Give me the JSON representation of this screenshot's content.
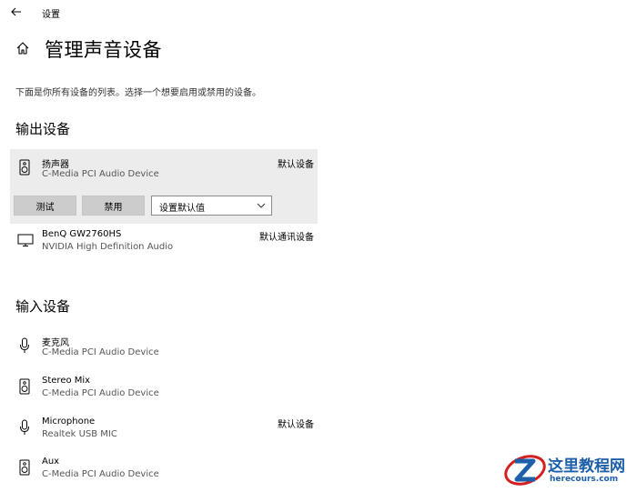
{
  "window": {
    "title": "设置",
    "back_icon": "back-arrow-icon"
  },
  "header": {
    "home_icon": "home-icon",
    "title": "管理声音设备",
    "description": "下面是你所有设备的列表。选择一个想要启用或禁用的设备。"
  },
  "output": {
    "section_title": "输出设备",
    "devices": [
      {
        "name": "扬声器",
        "subtitle": "C-Media PCI Audio Device",
        "status": "默认设备",
        "icon": "speaker-icon",
        "selected": true,
        "actions": {
          "test_label": "测试",
          "disable_label": "禁用",
          "default_select_value": "设置默认值"
        }
      },
      {
        "name": "BenQ GW2760HS",
        "subtitle": "NVIDIA High Definition Audio",
        "status": "默认通讯设备",
        "icon": "monitor-icon"
      }
    ]
  },
  "input": {
    "section_title": "输入设备",
    "devices": [
      {
        "name": "麦克风",
        "subtitle": "C-Media PCI Audio Device",
        "status": "",
        "icon": "microphone-icon"
      },
      {
        "name": "Stereo Mix",
        "subtitle": "C-Media PCI Audio Device",
        "status": "",
        "icon": "speaker-icon"
      },
      {
        "name": "Microphone",
        "subtitle": "Realtek USB MIC",
        "status": "默认设备",
        "icon": "microphone-icon"
      },
      {
        "name": "Aux",
        "subtitle": "C-Media PCI Audio Device",
        "status": "",
        "icon": "speaker-icon"
      }
    ]
  },
  "watermark": {
    "text": "这里教程网",
    "url": "herecours.com",
    "colors": {
      "blue": "#1d5fa8",
      "red": "#d42020"
    }
  }
}
